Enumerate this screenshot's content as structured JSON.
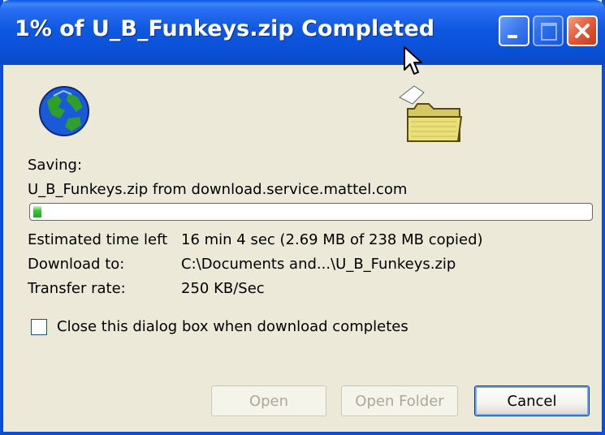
{
  "window": {
    "title": "1% of U_B_Funkeys.zip Completed",
    "titlebar_color": "#0a50d6",
    "buttons": [
      "minimize-icon",
      "maximize-icon",
      "close-icon"
    ]
  },
  "icons": {
    "globe": "globe-icon",
    "folder": "folder-icon"
  },
  "download": {
    "saving_label": "Saving:",
    "source": "U_B_Funkeys.zip from download.service.mattel.com",
    "progress_fraction": 0.01,
    "progress_color": "#22a81e",
    "time_left_label": "Estimated time left",
    "time_left_value": "16 min 4 sec (2.69 MB of 238 MB copied)",
    "download_to_label": "Download to:",
    "download_to_value": "C:\\Documents and...\\U_B_Funkeys.zip",
    "transfer_rate_label": "Transfer rate:",
    "transfer_rate_value": "250 KB/Sec"
  },
  "options": {
    "close_on_complete_label": "Close this dialog box when download completes",
    "close_on_complete_checked": false
  },
  "buttons": {
    "open": "Open",
    "open_folder": "Open Folder",
    "cancel": "Cancel"
  }
}
